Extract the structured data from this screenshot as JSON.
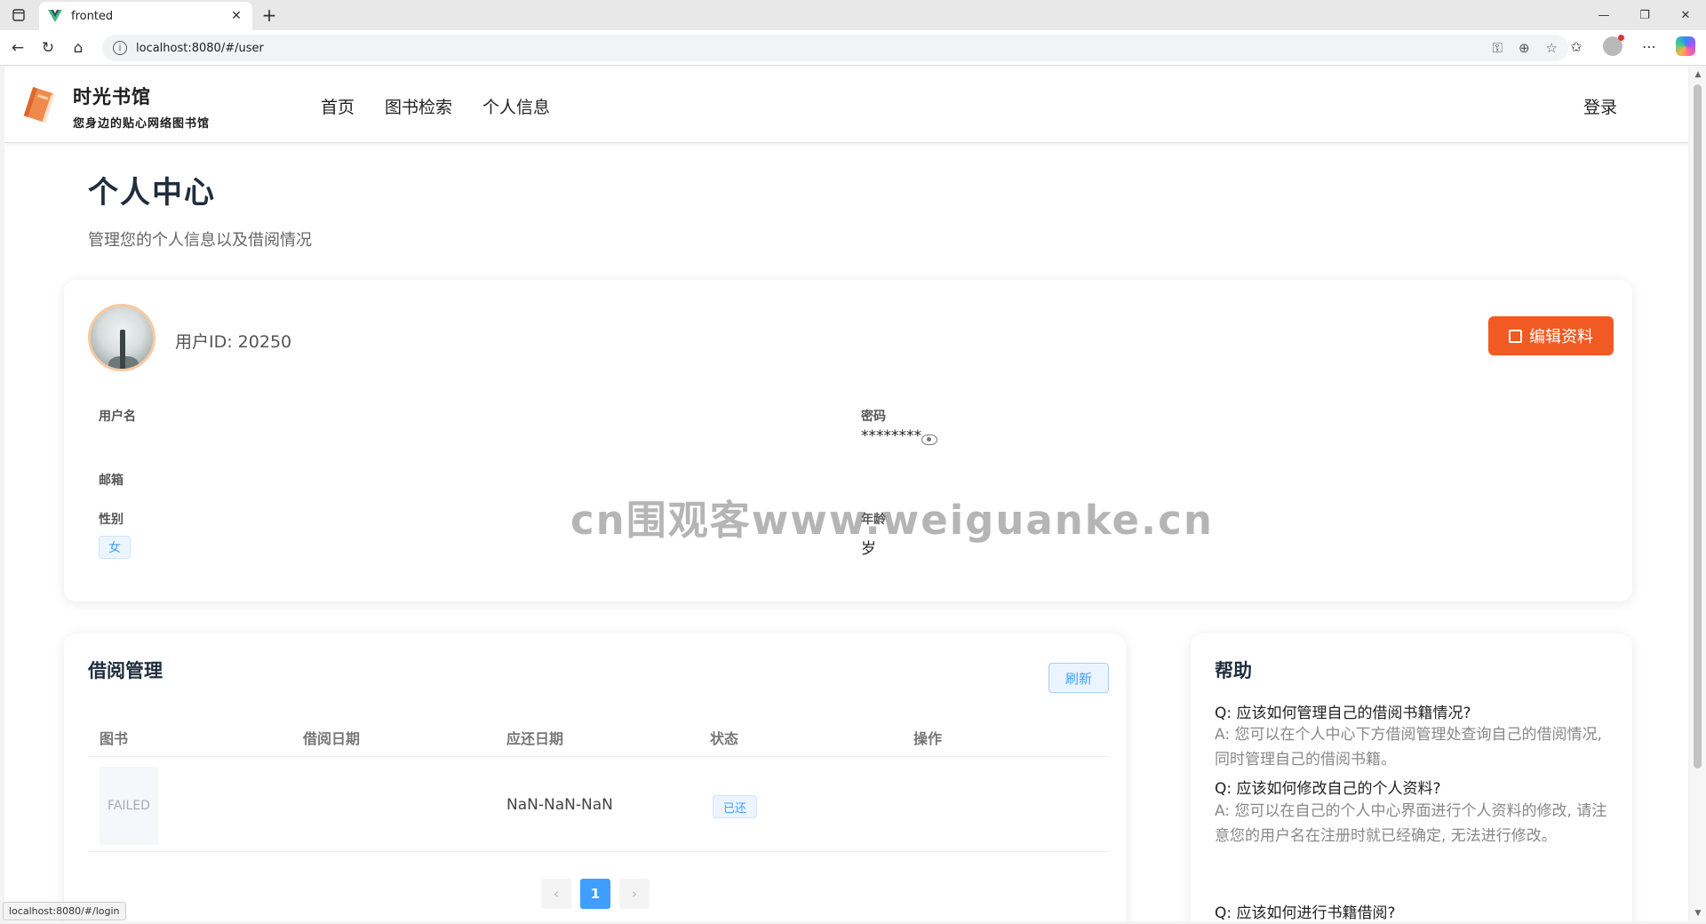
{
  "browser": {
    "tab_title": "fronted",
    "url": "localhost:8080/#/user",
    "status_url": "localhost:8080/#/login"
  },
  "site": {
    "title": "时光书馆",
    "subtitle": "您身边的贴心网络图书馆",
    "nav": [
      "首页",
      "图书检索",
      "个人信息"
    ],
    "login": "登录"
  },
  "page": {
    "title": "个人中心",
    "description": "管理您的个人信息以及借阅情况"
  },
  "profile": {
    "user_id": "用户ID: 20250",
    "edit_label": "编辑资料",
    "username_label": "用户名",
    "username_value": "",
    "password_label": "密码",
    "password_value": "********",
    "email_label": "邮箱",
    "email_value": "",
    "gender_label": "性别",
    "gender_value": "女",
    "age_label": "年龄",
    "age_value": "岁"
  },
  "borrow": {
    "title": "借阅管理",
    "refresh_label": "刷新",
    "columns": [
      "图书",
      "借阅日期",
      "应还日期",
      "状态",
      "操作"
    ],
    "rows": [
      {
        "image_text": "FAILED",
        "borrow_date": "",
        "due_date": "NaN-NaN-NaN",
        "status": "已还",
        "action": ""
      }
    ],
    "pager": {
      "prev": "‹",
      "current": "1",
      "next": "›"
    }
  },
  "help": {
    "title": "帮助",
    "items": [
      {
        "q": "Q: 应该如何管理自己的借阅书籍情况?",
        "a": "A: 您可以在个人中心下方借阅管理处查询自己的借阅情况, 同时管理自己的借阅书籍。"
      },
      {
        "q": "Q: 应该如何修改自己的个人资料?",
        "a": "A: 您可以在自己的个人中心界面进行个人资料的修改, 请注意您的用户名在注册时就已经确定, 无法进行修改。"
      },
      {
        "q": "Q: 应该如何进行书籍借阅?"
      }
    ]
  },
  "watermark": "cn围观客www.weiguanke.cn",
  "colors": {
    "accent": "#f15a22",
    "primary": "#409eff"
  }
}
